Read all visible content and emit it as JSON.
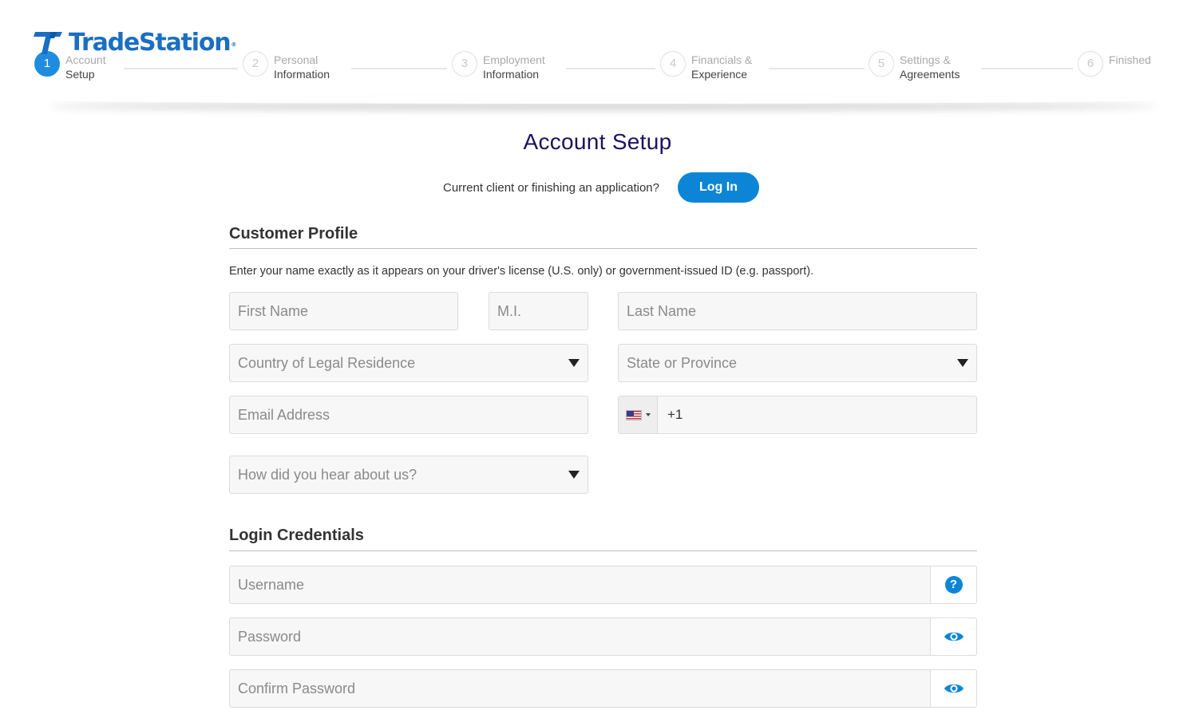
{
  "brand": {
    "name": "TradeStation",
    "color": "#1a6fc2"
  },
  "steps": [
    {
      "number": "1",
      "line1": "Account",
      "line2": "Setup",
      "active": true
    },
    {
      "number": "2",
      "line1": "Personal",
      "line2": "Information",
      "active": false
    },
    {
      "number": "3",
      "line1": "Employment",
      "line2": "Information",
      "active": false
    },
    {
      "number": "4",
      "line1": "Financials &",
      "line2": "Experience",
      "active": false
    },
    {
      "number": "5",
      "line1": "Settings &",
      "line2": "Agreements",
      "active": false
    },
    {
      "number": "6",
      "line1": "Finished",
      "line2": "",
      "active": false
    }
  ],
  "page_title": "Account Setup",
  "login": {
    "prompt": "Current client or finishing an application?",
    "button": "Log In"
  },
  "customer_profile": {
    "title": "Customer Profile",
    "note": "Enter your name exactly as it appears on your driver's license (U.S. only) or government-issued ID (e.g. passport).",
    "first_name_placeholder": "First Name",
    "mi_placeholder": "M.I.",
    "last_name_placeholder": "Last Name",
    "country_placeholder": "Country of Legal Residence",
    "state_placeholder": "State or Province",
    "email_placeholder": "Email Address",
    "phone_prefix": "+1",
    "phone_flag": "us-flag-icon",
    "referral_placeholder": "How did you hear about us?"
  },
  "login_credentials": {
    "title": "Login Credentials",
    "username_placeholder": "Username",
    "help_icon": "?",
    "password_placeholder": "Password",
    "confirm_password_placeholder": "Confirm Password"
  },
  "colors": {
    "accent": "#0c85d6",
    "title": "#1d1160",
    "active_step": "#1f8ce0"
  }
}
